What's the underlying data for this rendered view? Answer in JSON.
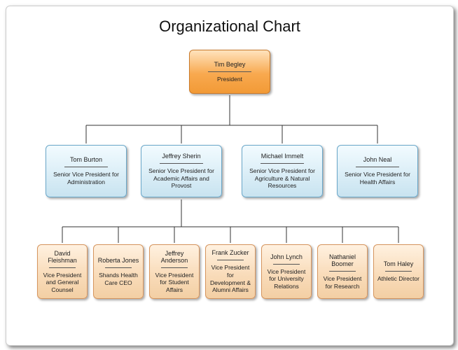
{
  "title": "Organizational Chart",
  "chart_data": {
    "type": "tree",
    "root": {
      "name": "Tim Begley",
      "title": "President",
      "children": [
        {
          "name": "Tom Burton",
          "title": "Senior Vice President for Administration"
        },
        {
          "name": "Jeffrey Sherin",
          "title": "Senior Vice President for Academic Affairs and Provost",
          "children": [
            {
              "name": "David Fleishman",
              "title": "Vice President and General Counsel"
            },
            {
              "name": "Roberta Jones",
              "title": "Shands Health Care CEO"
            },
            {
              "name": "Jeffrey Anderson",
              "title": "Vice President for Student Affairs"
            },
            {
              "name": "Frank Zucker",
              "title": "Vice President for Development & Alumni Affairs"
            },
            {
              "name": "John Lynch",
              "title": "Vice President for University Relations"
            },
            {
              "name": "Nathaniel Boomer",
              "title": "Vice President for Research"
            },
            {
              "name": "Tom Haley",
              "title": "Athletic Director"
            }
          ]
        },
        {
          "name": "Michael Immelt",
          "title": "Senior Vice President for Agriculture & Natural Resources"
        },
        {
          "name": "John Neal",
          "title": "Senior Vice President for Health Affairs"
        }
      ]
    }
  },
  "nodes": {
    "root": {
      "name": "Tim Begley",
      "title": "President"
    },
    "svp1": {
      "name": "Tom Burton",
      "title": "Senior Vice President for Administration"
    },
    "svp2": {
      "name": "Jeffrey Sherin",
      "title": "Senior Vice President for Academic Affairs and Provost"
    },
    "svp3": {
      "name": "Michael Immelt",
      "title": "Senior Vice President for Agriculture & Natural Resources"
    },
    "svp4": {
      "name": "John Neal",
      "title": "Senior Vice President for Health Affairs"
    },
    "vp1": {
      "name": "David Fleishman",
      "title": "Vice President and General Counsel"
    },
    "vp2": {
      "name": "Roberta Jones",
      "title": "Shands Health Care CEO"
    },
    "vp3": {
      "name": "Jeffrey Anderson",
      "title": "Vice President for Student Affairs"
    },
    "vp4": {
      "name": "Frank Zucker",
      "title": "Vice President for Development & Alumni Affairs"
    },
    "vp5": {
      "name": "John Lynch",
      "title": "Vice President for University Relations"
    },
    "vp6": {
      "name": "Nathaniel Boomer",
      "title": "Vice President for Research"
    },
    "vp7": {
      "name": "Tom Haley",
      "title": "Athletic Director"
    }
  }
}
